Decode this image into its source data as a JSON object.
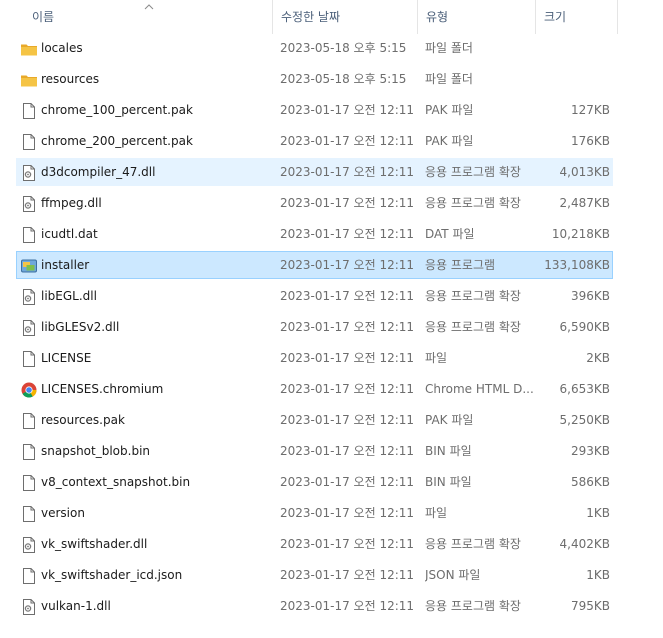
{
  "columns": {
    "name": "이름",
    "date": "수정한 날짜",
    "type": "유형",
    "size": "크기"
  },
  "files": [
    {
      "name": "locales",
      "date": "2023-05-18 오후 5:15",
      "type": "파일 폴더",
      "size": "",
      "icon": "folder-icon"
    },
    {
      "name": "resources",
      "date": "2023-05-18 오후 5:15",
      "type": "파일 폴더",
      "size": "",
      "icon": "folder-icon"
    },
    {
      "name": "chrome_100_percent.pak",
      "date": "2023-01-17 오전 12:11",
      "type": "PAK 파일",
      "size": "127KB",
      "icon": "file-icon"
    },
    {
      "name": "chrome_200_percent.pak",
      "date": "2023-01-17 오전 12:11",
      "type": "PAK 파일",
      "size": "176KB",
      "icon": "file-icon"
    },
    {
      "name": "d3dcompiler_47.dll",
      "date": "2023-01-17 오전 12:11",
      "type": "응용 프로그램 확장",
      "size": "4,013KB",
      "icon": "dll-icon",
      "state": "hover"
    },
    {
      "name": "ffmpeg.dll",
      "date": "2023-01-17 오전 12:11",
      "type": "응용 프로그램 확장",
      "size": "2,487KB",
      "icon": "dll-icon"
    },
    {
      "name": "icudtl.dat",
      "date": "2023-01-17 오전 12:11",
      "type": "DAT 파일",
      "size": "10,218KB",
      "icon": "file-icon"
    },
    {
      "name": "installer",
      "date": "2023-01-17 오전 12:11",
      "type": "응용 프로그램",
      "size": "133,108KB",
      "icon": "installer-icon",
      "state": "selected"
    },
    {
      "name": "libEGL.dll",
      "date": "2023-01-17 오전 12:11",
      "type": "응용 프로그램 확장",
      "size": "396KB",
      "icon": "dll-icon"
    },
    {
      "name": "libGLESv2.dll",
      "date": "2023-01-17 오전 12:11",
      "type": "응용 프로그램 확장",
      "size": "6,590KB",
      "icon": "dll-icon"
    },
    {
      "name": "LICENSE",
      "date": "2023-01-17 오전 12:11",
      "type": "파일",
      "size": "2KB",
      "icon": "file-icon"
    },
    {
      "name": "LICENSES.chromium",
      "date": "2023-01-17 오전 12:11",
      "type": "Chrome HTML D...",
      "size": "6,653KB",
      "icon": "chrome-icon"
    },
    {
      "name": "resources.pak",
      "date": "2023-01-17 오전 12:11",
      "type": "PAK 파일",
      "size": "5,250KB",
      "icon": "file-icon"
    },
    {
      "name": "snapshot_blob.bin",
      "date": "2023-01-17 오전 12:11",
      "type": "BIN 파일",
      "size": "293KB",
      "icon": "file-icon"
    },
    {
      "name": "v8_context_snapshot.bin",
      "date": "2023-01-17 오전 12:11",
      "type": "BIN 파일",
      "size": "586KB",
      "icon": "file-icon"
    },
    {
      "name": "version",
      "date": "2023-01-17 오전 12:11",
      "type": "파일",
      "size": "1KB",
      "icon": "file-icon"
    },
    {
      "name": "vk_swiftshader.dll",
      "date": "2023-01-17 오전 12:11",
      "type": "응용 프로그램 확장",
      "size": "4,402KB",
      "icon": "dll-icon"
    },
    {
      "name": "vk_swiftshader_icd.json",
      "date": "2023-01-17 오전 12:11",
      "type": "JSON 파일",
      "size": "1KB",
      "icon": "file-icon"
    },
    {
      "name": "vulkan-1.dll",
      "date": "2023-01-17 오전 12:11",
      "type": "응용 프로그램 확장",
      "size": "795KB",
      "icon": "dll-icon"
    }
  ],
  "colors": {
    "hover": "#e5f3ff",
    "selected": "#cce8ff",
    "selected_border": "#99d1ff",
    "folder": "#f5c445",
    "header_text": "#4c607a"
  }
}
